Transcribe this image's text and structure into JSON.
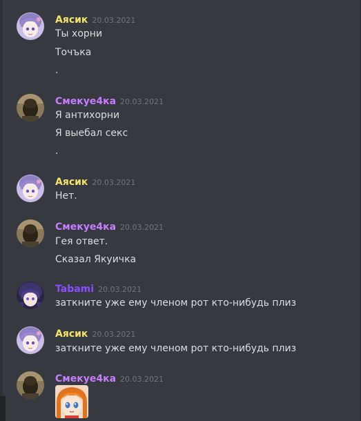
{
  "colors": {
    "background": "#36393f",
    "ayasik_name": "#f4e36b",
    "smekue_name": "#c77dff",
    "tabami_name": "#8a4dff",
    "message_text": "#dcddde",
    "timestamp": "#72767d"
  },
  "messages": [
    {
      "username": "Аясик",
      "timestamp": "20.03.2021",
      "lines": [
        "Ты хорни",
        "Точъка",
        "."
      ]
    },
    {
      "username": "Смекуе4ка",
      "timestamp": "20.03.2021",
      "lines": [
        "Я антихорни",
        "Я выебал секс",
        "."
      ]
    },
    {
      "username": "Аясик",
      "timestamp": "20.03.2021",
      "lines": [
        "Нет."
      ]
    },
    {
      "username": "Смекуе4ка",
      "timestamp": "20.03.2021",
      "lines": [
        "Гея ответ.",
        "Сказал Якуичка"
      ]
    },
    {
      "username": "Tabami",
      "timestamp": "20.03.2021",
      "lines": [
        "заткните уже ему членом рот кто-нибудь плиз"
      ]
    },
    {
      "username": "Аясик",
      "timestamp": "20.03.2021",
      "lines": [
        "заткните уже ему членом рот кто-нибудь плиз"
      ]
    },
    {
      "username": "Смекуе4ка",
      "timestamp": "20.03.2021",
      "lines": [],
      "attachment": "anime-emoji-image"
    }
  ]
}
